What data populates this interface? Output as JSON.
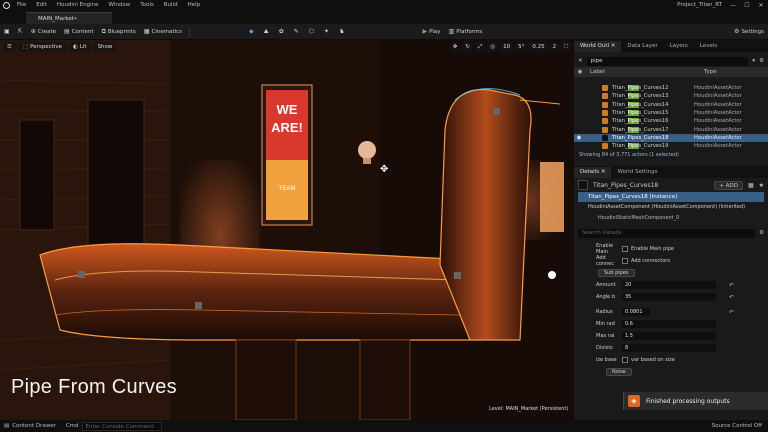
{
  "menubar": {
    "items": [
      "File",
      "Edit",
      "Houdini Engine",
      "Window",
      "Tools",
      "Build",
      "Help"
    ],
    "project": "Project_Titan_RT",
    "window_controls": [
      "—",
      "☐",
      "✕"
    ]
  },
  "doc_tab": {
    "label": "MAIN_Market•"
  },
  "toolbar": {
    "create": "Create",
    "content": "Content",
    "blueprints": "Blueprints",
    "cinematics": "Cinematics",
    "play": "Play",
    "platforms": "Platforms",
    "settings": "Settings"
  },
  "viewport": {
    "perspective": "Perspective",
    "lit": "Lit",
    "show": "Show",
    "grid_snap": "10",
    "angle_snap": "5°",
    "scale_snap": "0.25",
    "camera_speed": "2",
    "overlay_title": "Pipe From Curves",
    "level_label": "Level: MAIN_Market (Persistent)",
    "billboard_text": [
      "WE",
      "ARE!"
    ],
    "billboard_sub": "TEAM"
  },
  "outliner": {
    "tabs": [
      "World Outl ✕",
      "Data Layer",
      "Layers",
      "Levels"
    ],
    "search": "pipe",
    "col_label": "Label",
    "col_type": "Type",
    "rows": [
      {
        "pre": "Titan_",
        "hl": "Pipe",
        "post": "s_Curves12",
        "type": "HoudiniAssetActor"
      },
      {
        "pre": "Titan_",
        "hl": "Pipe",
        "post": "s_Curves13",
        "type": "HoudiniAssetActor"
      },
      {
        "pre": "Titan_",
        "hl": "Pipe",
        "post": "s_Curves14",
        "type": "HoudiniAssetActor"
      },
      {
        "pre": "Titan_",
        "hl": "Pipe",
        "post": "s_Curves15",
        "type": "HoudiniAssetActor"
      },
      {
        "pre": "Titan_",
        "hl": "Pipe",
        "post": "s_Curves16",
        "type": "HoudiniAssetActor"
      },
      {
        "pre": "Titan_",
        "hl": "Pipe",
        "post": "s_Curves17",
        "type": "HoudiniAssetActor"
      },
      {
        "pre": "Titan_Pipes_Curves18",
        "hl": "",
        "post": "",
        "type": "HoudiniAssetActor",
        "selected": true
      },
      {
        "pre": "Titan_",
        "hl": "Pipe",
        "post": "s_Curves19",
        "type": "HoudiniAssetActor"
      }
    ],
    "status": "Showing 84 of 3,771 actors (1 selected)"
  },
  "details": {
    "tabs": [
      "Details ✕",
      "World Settings"
    ],
    "actor_name": "Titan_Pipes_Curves18",
    "add_label": "+ ADD",
    "instance": "Titan_Pipes_Curves18 (Instance)",
    "component": "HoudiniAssetComponent (HoudiniAssetComponent) (Inherited)",
    "static_mesh": "HoudiniStaticMeshComponent_0",
    "search_placeholder": "Search Details",
    "props": {
      "enable_main": "Enable Main",
      "enable_main_val": "Enable Main pipe",
      "add_conn": "Add connec",
      "add_conn_val": "Add connectors",
      "sub_pipes": "Sub pipes",
      "amount": "Amount",
      "amount_val": "20",
      "angle": "Angle b",
      "angle_val": "35",
      "radius": "Radius",
      "radius_val": "0.0801",
      "min_rad": "Min rad",
      "min_rad_val": "0.6",
      "max_rad": "Max rai",
      "max_rad_val": "1.5",
      "divisions": "Divisio",
      "divisions_val": "8",
      "var_based": "ize base",
      "var_based_val": "var based on size",
      "noise": "Noise"
    }
  },
  "toast": {
    "text": "Finished processing outputs"
  },
  "status": {
    "content_drawer": "Content Drawer",
    "cmd": "Cmd",
    "cmd_placeholder": "Enter Console Command",
    "source_control": "Source Control Off"
  }
}
